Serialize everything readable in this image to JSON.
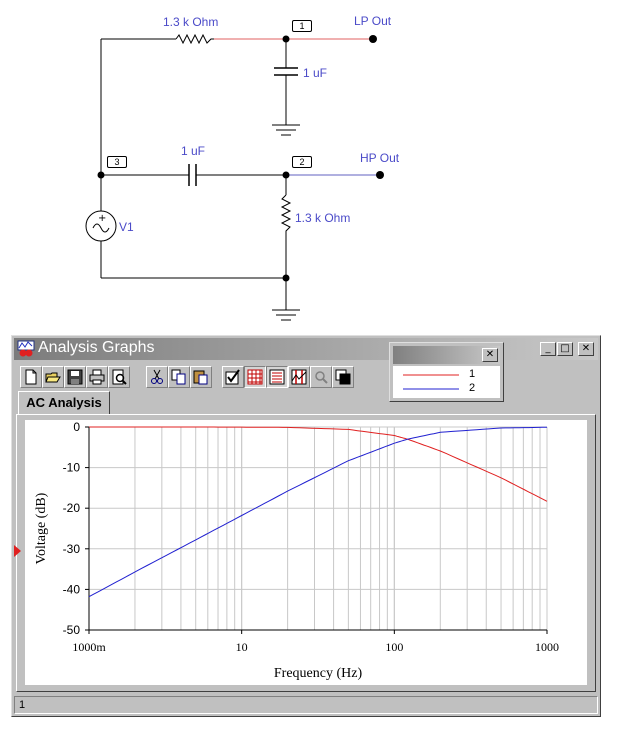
{
  "schematic": {
    "resistor_top": "1.3 k Ohm",
    "capacitor_top": "1 uF",
    "capacitor_mid": "1 uF",
    "resistor_right": "1.3 k Ohm",
    "lp_out": "LP Out",
    "hp_out": "HP Out",
    "source": "V1",
    "node1": "1",
    "node2": "2",
    "node3": "3"
  },
  "window": {
    "title": "Analysis Graphs",
    "tab": "AC Analysis",
    "status": "1",
    "min_glyph": "_",
    "max_glyph": "□",
    "close_glyph": "✕"
  },
  "toolbar": {
    "icons": [
      "new-file-icon",
      "open-folder-icon",
      "save-disk-icon",
      "print-icon",
      "print-preview-icon",
      "cut-scissors-icon",
      "copy-icon",
      "paste-icon",
      "properties-check-icon",
      "grid-icon",
      "legend-list-icon",
      "cursors-icon",
      "zoom-icon",
      "restore-graph-icon"
    ]
  },
  "legend": {
    "close_glyph": "✕",
    "entries": [
      {
        "label": "1",
        "color": "#e02020"
      },
      {
        "label": "2",
        "color": "#2020d0"
      }
    ]
  },
  "colors": {
    "series_lp": "#e02020",
    "series_hp": "#2020d0",
    "wire": "#000000",
    "wire_hot": "#e06060",
    "label_blue": "#4a4ac8"
  },
  "chart_data": {
    "type": "line",
    "title": "",
    "xlabel": "Frequency (Hz)",
    "ylabel": "Voltage (dB)",
    "xscale": "log",
    "xlim": [
      1,
      1000
    ],
    "ylim": [
      -50,
      0
    ],
    "xticks": [
      1,
      10,
      100,
      1000
    ],
    "xtick_labels": [
      "1000m",
      "10",
      "100",
      "1000"
    ],
    "yticks": [
      0,
      -10,
      -20,
      -30,
      -40,
      -50
    ],
    "ytick_labels": [
      "0",
      "-10",
      "-20",
      "-30",
      "-40",
      "-50"
    ],
    "grid": true,
    "series": [
      {
        "name": "1",
        "color": "#e02020",
        "x": [
          1,
          2,
          5,
          10,
          20,
          50,
          100,
          122,
          200,
          500,
          1000
        ],
        "y": [
          0,
          0,
          0,
          -0.03,
          -0.1,
          -0.6,
          -2.1,
          -3,
          -5.9,
          -12.5,
          -18.3
        ]
      },
      {
        "name": "2",
        "color": "#2020d0",
        "x": [
          1,
          2,
          5,
          10,
          20,
          50,
          100,
          122,
          200,
          500,
          1000
        ],
        "y": [
          -41.8,
          -35.7,
          -27.8,
          -21.8,
          -15.8,
          -8.3,
          -4.0,
          -3,
          -1.3,
          -0.25,
          -0.06
        ]
      }
    ]
  }
}
